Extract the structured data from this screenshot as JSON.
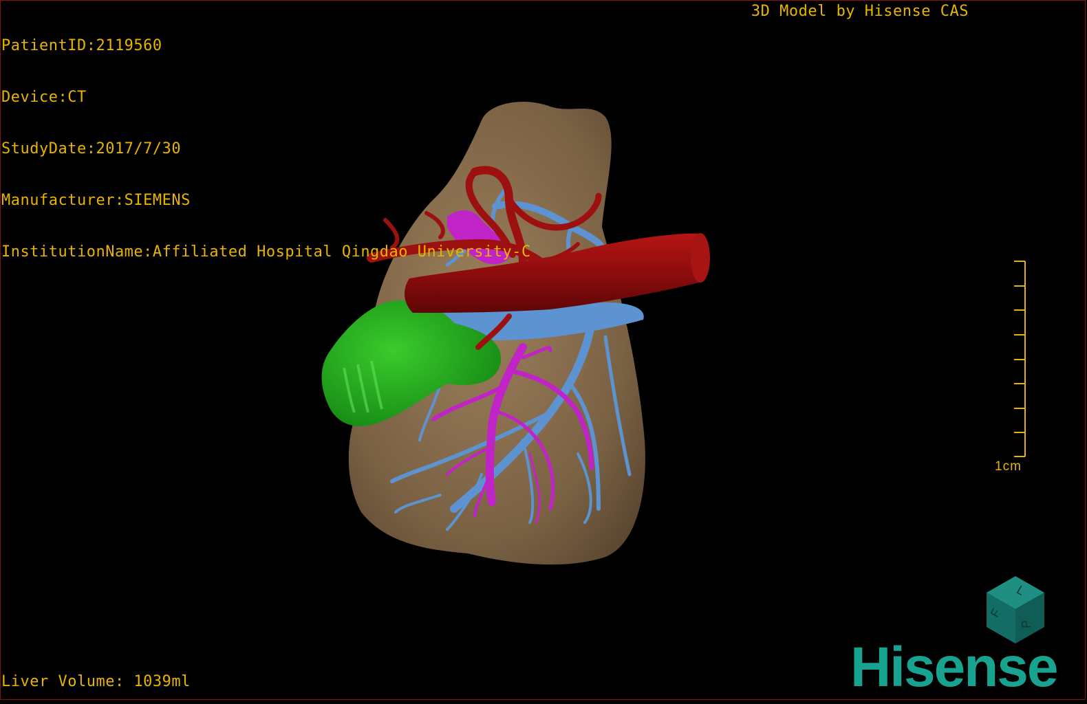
{
  "header": {
    "patient_line": "PatientID:2119560",
    "device_line": "Device:CT",
    "date_line": "StudyDate:2017/7/30",
    "manufacturer_line": "Manufacturer:SIEMENS",
    "institution_line": "InstitutionName:Affiliated Hospital Qingdao University-C"
  },
  "credit": "3D Model by Hisense CAS",
  "footer": {
    "volume_line": "Liver Volume: 1039ml"
  },
  "scale_bar": {
    "label": "1cm"
  },
  "orientation_cube": {
    "faces": [
      "F",
      "L",
      "P"
    ]
  },
  "brand": "Hisense",
  "colors": {
    "overlay_text": "#e8b400",
    "liver": "#8c7150",
    "artery": "#9c1010",
    "portal_vein": "#c024c6",
    "hepatic_vein": "#5d93d0",
    "gallbladder": "#18a018",
    "brand": "#17a38f"
  }
}
